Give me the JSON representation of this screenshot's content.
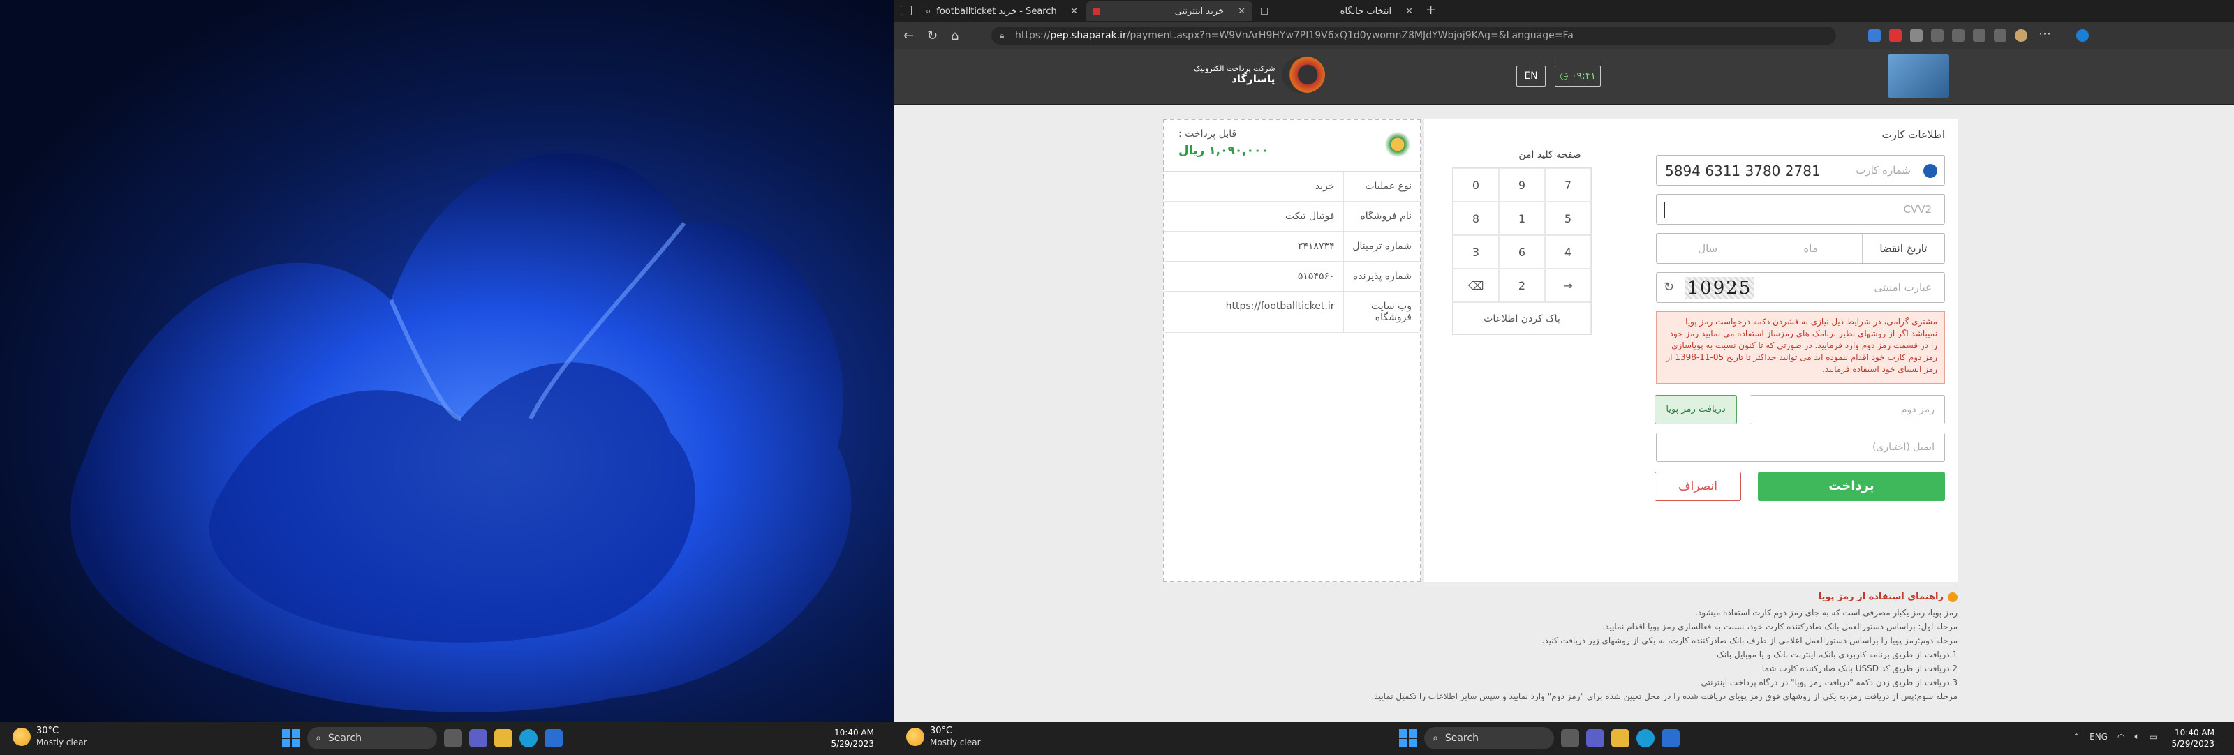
{
  "left_monitor": {
    "taskbar": {
      "weather_temp": "30°C",
      "weather_desc": "Mostly clear",
      "search_label": "Search",
      "time": "10:40 AM",
      "date": "5/29/2023"
    }
  },
  "browser": {
    "tabs": [
      {
        "title": "footballticket خرید - Search"
      },
      {
        "title": "خرید اینترنتی"
      },
      {
        "title": "انتخاب جایگاه"
      }
    ],
    "url_prefix": "https://",
    "url_host": "pep.shaparak.ir",
    "url_path": "/payment.aspx?n=W9VnArH9HYw7PI19V6xQ1d0ywomnZ8MJdYWbjoj9KAg=&Language=Fa"
  },
  "header": {
    "en_button": "EN",
    "timer": "۰۹:۴۱",
    "psp_logo_line1": "شرکت پرداخت الکترونیک",
    "psp_logo_line2": "پاسارگاد"
  },
  "receipt": {
    "amount_label": "قابل پرداخت :",
    "amount": "۱,۰۹۰,۰۰۰ ریال",
    "rows": [
      {
        "label": "نوع عملیات",
        "value": "خرید"
      },
      {
        "label": "نام فروشگاه",
        "value": "فوتبال تیکت"
      },
      {
        "label": "شماره ترمینال",
        "value": "۲۴۱۸۷۳۴"
      },
      {
        "label": "شماره پذیرنده",
        "value": "۵۱۵۴۵۶۰"
      },
      {
        "label": "وب سایت فروشگاه",
        "value": "https://footballticket.ir"
      }
    ]
  },
  "form": {
    "title": "اطلاعات کارت",
    "card_number_label": "شماره کارت",
    "card_number": "5894 6311 3780 2781",
    "cvv2_placeholder": "CVV2",
    "expiry_label": "تاریخ انقضا",
    "month_placeholder": "ماه",
    "year_placeholder": "سال",
    "captcha_label": "عبارت امنیتی",
    "captcha_text": "10925",
    "warning": "مشتری گرامی، در شرایط ذیل نیازی به فشردن دکمه درخواست رمز پویا نمیباشد اگر از روشهای نظیر برنامک های رمزساز استفاده می نمایید رمز خود را در قسمت رمز دوم وارد فرمایید. در صورتی که تا کنون نسبت به پویاسازی رمز دوم کارت خود اقدام ننموده اید می توانید حداکثر تا تاریخ 05-11-1398 از رمز ایستای خود استفاده فرمایید.",
    "pin2_placeholder": "رمز دوم",
    "otp_button": "دریافت رمز پویا",
    "email_placeholder": "ایمیل (اختیاری)",
    "pay_button": "پرداخت",
    "cancel_button": "انصراف",
    "keypad_title": "صفحه کلید امن",
    "keypad_keys": [
      "7",
      "9",
      "0",
      "5",
      "1",
      "8",
      "4",
      "6",
      "3",
      "→",
      "2",
      "⌫"
    ],
    "keypad_clear": "پاک کردن اطلاعات"
  },
  "guide": {
    "title": "راهنمای استفاده از رمز پویا",
    "lines": [
      "رمز پویا، رمز یکبار مصرفی است که به جای رمز دوم کارت استفاده میشود.",
      "مرحله اول: براساس دستورالعمل بانک صادرکننده کارت خود، نسبت به فعالسازی رمز پویا اقدام نمایید.",
      "مرحله دوم:رمز پویا را براساس دستورالعمل اعلامی از طرف بانک صادرکننده کارت، به یکی از روشهای زیر دریافت کنید.",
      "1.دریافت از طریق برنامه کاربردی بانک، اینترنت بانک و یا موبایل بانک",
      "2.دریافت از طریق کد USSD بانک صادرکننده کارت شما",
      "3.دریافت از طریق زدن دکمه \"دریافت رمز پویا\" در درگاه پرداخت اینترنتی",
      "مرحله سوم:پس از دریافت رمز،به یکی از روشهای فوق رمز پویای دریافت شده را در محل تعیین شده برای \"رمز دوم\" وارد نمایید و سپس سایر اطلاعات را تکمیل نمایید."
    ]
  },
  "right_taskbar": {
    "weather_temp": "30°C",
    "weather_desc": "Mostly clear",
    "search_label": "Search",
    "lang": "ENG",
    "time": "10:40 AM",
    "date": "5/29/2023"
  }
}
